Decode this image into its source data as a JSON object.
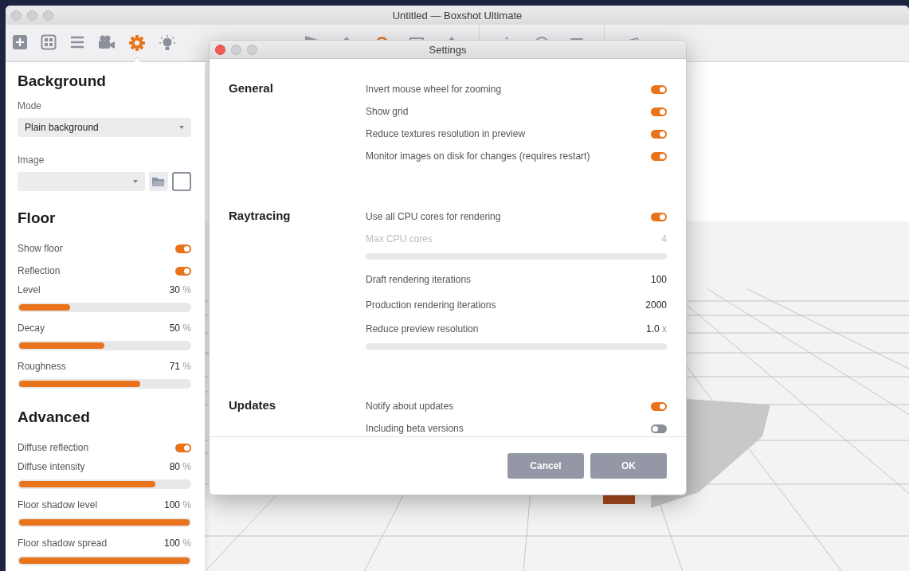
{
  "window": {
    "title": "Untitled — Boxshot Ultimate"
  },
  "tabs": [
    {
      "selected": false
    },
    {
      "selected": false
    },
    {
      "selected": false
    },
    {
      "selected": false
    },
    {
      "selected": true
    },
    {
      "selected": false
    }
  ],
  "sidebar": {
    "sections": [
      {
        "title": "Background",
        "rows": [
          {
            "kind": "dropdown",
            "label": "Mode",
            "value": "Plain background"
          },
          {
            "kind": "image",
            "label": "Image"
          }
        ]
      },
      {
        "title": "Floor",
        "rows": [
          {
            "kind": "toggle",
            "label": "Show floor",
            "on": true
          },
          {
            "kind": "toggle",
            "label": "Reflection",
            "on": true
          },
          {
            "kind": "slider",
            "label": "Level",
            "value": "30",
            "unit": "%",
            "level": 0.3
          },
          {
            "kind": "slider",
            "label": "Decay",
            "value": "50",
            "unit": "%",
            "level": 0.5
          },
          {
            "kind": "slider",
            "label": "Roughness",
            "value": "71",
            "unit": "%",
            "level": 0.71
          }
        ]
      },
      {
        "title": "Advanced",
        "rows": [
          {
            "kind": "toggle",
            "label": "Diffuse reflection",
            "on": true
          },
          {
            "kind": "slider",
            "label": "Diffuse intensity",
            "value": "80",
            "unit": "%",
            "level": 0.8
          },
          {
            "kind": "slider",
            "label": "Floor shadow level",
            "value": "100",
            "unit": "%",
            "level": 1
          },
          {
            "kind": "slider",
            "label": "Floor shadow spread",
            "value": "100",
            "unit": "%",
            "level": 1
          }
        ]
      }
    ]
  },
  "settings": {
    "title": "Settings",
    "sections": [
      {
        "title": "General",
        "rows": [
          {
            "kind": "toggle",
            "label": "Invert mouse wheel for zooming",
            "on": true
          },
          {
            "kind": "toggle",
            "label": "Show grid",
            "on": true
          },
          {
            "kind": "toggle",
            "label": "Reduce textures resolution in preview",
            "on": true
          },
          {
            "kind": "toggle",
            "label": "Monitor images on disk for changes (requires restart)",
            "on": true
          }
        ]
      },
      {
        "title": "Raytracing",
        "rows": [
          {
            "kind": "toggle",
            "label": "Use all CPU cores for rendering",
            "on": true
          },
          {
            "kind": "slider",
            "label": "Max CPU cores",
            "value": "4",
            "disabled": true
          },
          {
            "kind": "number",
            "label": "Draft rendering iterations",
            "value": "100"
          },
          {
            "kind": "number",
            "label": "Production rendering iterations",
            "value": "2000"
          },
          {
            "kind": "slider",
            "label": "Reduce preview resolution",
            "value": "1.0",
            "unit": "x",
            "disabled": false
          }
        ]
      },
      {
        "title": "Updates",
        "rows": [
          {
            "kind": "toggle",
            "label": "Notify about updates",
            "on": true
          },
          {
            "kind": "toggle",
            "label": "Including beta versions",
            "on": false
          }
        ]
      }
    ],
    "buttons": [
      "Cancel",
      "OK"
    ]
  }
}
